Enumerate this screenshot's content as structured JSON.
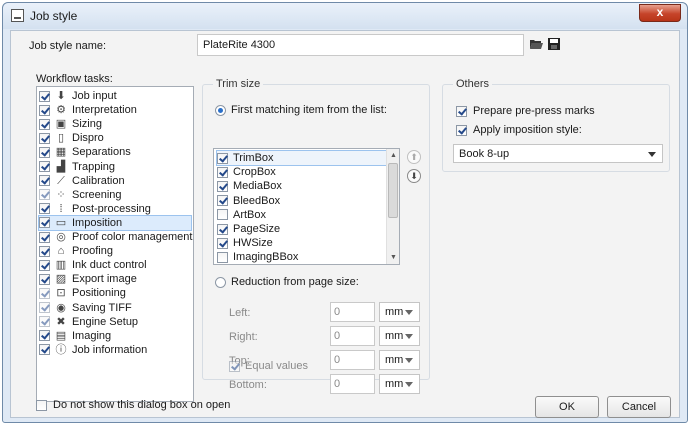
{
  "window": {
    "title": "Job style",
    "close_glyph": "x"
  },
  "job_style": {
    "label": "Job style name:",
    "value": "PlateRite 4300",
    "open_icon": "folder-open-icon",
    "save_icon": "save-icon"
  },
  "workflow": {
    "label": "Workflow tasks:",
    "tasks": [
      {
        "label": "Job input",
        "icon": "download-icon",
        "glyph": "⬇",
        "checked": true,
        "dim": false,
        "selected": false
      },
      {
        "label": "Interpretation",
        "icon": "gears-icon",
        "glyph": "⚙",
        "checked": true,
        "dim": false,
        "selected": false
      },
      {
        "label": "Sizing",
        "icon": "sizing-icon",
        "glyph": "▣",
        "checked": true,
        "dim": false,
        "selected": false
      },
      {
        "label": "Dispro",
        "icon": "page-icon",
        "glyph": "▯",
        "checked": true,
        "dim": false,
        "selected": false
      },
      {
        "label": "Separations",
        "icon": "separations-icon",
        "glyph": "▦",
        "checked": true,
        "dim": false,
        "selected": false
      },
      {
        "label": "Trapping",
        "icon": "trapping-icon",
        "glyph": "▟",
        "checked": true,
        "dim": false,
        "selected": false
      },
      {
        "label": "Calibration",
        "icon": "calibration-curve-icon",
        "glyph": "⟋",
        "checked": true,
        "dim": false,
        "selected": false
      },
      {
        "label": "Screening",
        "icon": "screening-dots-icon",
        "glyph": "⁘",
        "checked": true,
        "dim": true,
        "selected": false
      },
      {
        "label": "Post-processing",
        "icon": "post-processing-icon",
        "glyph": "⁞",
        "checked": true,
        "dim": false,
        "selected": false
      },
      {
        "label": "Imposition",
        "icon": "book-icon",
        "glyph": "▭",
        "checked": true,
        "dim": false,
        "selected": true
      },
      {
        "label": "Proof color management",
        "icon": "color-wheel-icon",
        "glyph": "◎",
        "checked": true,
        "dim": false,
        "selected": false
      },
      {
        "label": "Proofing",
        "icon": "proofing-icon",
        "glyph": "⌂",
        "checked": true,
        "dim": false,
        "selected": false
      },
      {
        "label": "Ink duct control",
        "icon": "bar-graph-icon",
        "glyph": "▥",
        "checked": true,
        "dim": false,
        "selected": false
      },
      {
        "label": "Export image",
        "icon": "image-icon",
        "glyph": "▨",
        "checked": true,
        "dim": false,
        "selected": false
      },
      {
        "label": "Positioning",
        "icon": "positioning-icon",
        "glyph": "⊡",
        "checked": true,
        "dim": true,
        "selected": false
      },
      {
        "label": "Saving TIFF",
        "icon": "disk-icon",
        "glyph": "◉",
        "checked": true,
        "dim": true,
        "selected": false
      },
      {
        "label": "Engine Setup",
        "icon": "wrench-icon",
        "glyph": "✖",
        "checked": true,
        "dim": true,
        "selected": false
      },
      {
        "label": "Imaging",
        "icon": "printer-icon",
        "glyph": "▤",
        "checked": true,
        "dim": false,
        "selected": false
      },
      {
        "label": "Job information",
        "icon": "info-icon",
        "glyph": "ⓘ",
        "checked": true,
        "dim": false,
        "selected": false
      }
    ]
  },
  "trim": {
    "title": "Trim size",
    "first_match_label": "First matching item from the list:",
    "items": [
      {
        "label": "TrimBox",
        "checked": true,
        "selected": true
      },
      {
        "label": "CropBox",
        "checked": true,
        "selected": false
      },
      {
        "label": "MediaBox",
        "checked": true,
        "selected": false
      },
      {
        "label": "BleedBox",
        "checked": true,
        "selected": false
      },
      {
        "label": "ArtBox",
        "checked": false,
        "selected": false
      },
      {
        "label": "PageSize",
        "checked": true,
        "selected": false
      },
      {
        "label": "HWSize",
        "checked": true,
        "selected": false
      },
      {
        "label": "ImagingBBox",
        "checked": false,
        "selected": false
      }
    ],
    "reduction_label": "Reduction from page size:",
    "fields": [
      {
        "label": "Left:",
        "value": "0",
        "unit": "mm"
      },
      {
        "label": "Right:",
        "value": "0",
        "unit": "mm"
      },
      {
        "label": "Top:",
        "value": "0",
        "unit": "mm"
      },
      {
        "label": "Bottom:",
        "value": "0",
        "unit": "mm"
      }
    ],
    "equal_values_label": "Equal values"
  },
  "others": {
    "title": "Others",
    "prepress_label": "Prepare pre-press marks",
    "imposition_label": "Apply imposition style:",
    "imposition_value": "Book 8-up"
  },
  "footer": {
    "dont_show_label": "Do not show this dialog box on open",
    "ok_label": "OK",
    "cancel_label": "Cancel"
  }
}
